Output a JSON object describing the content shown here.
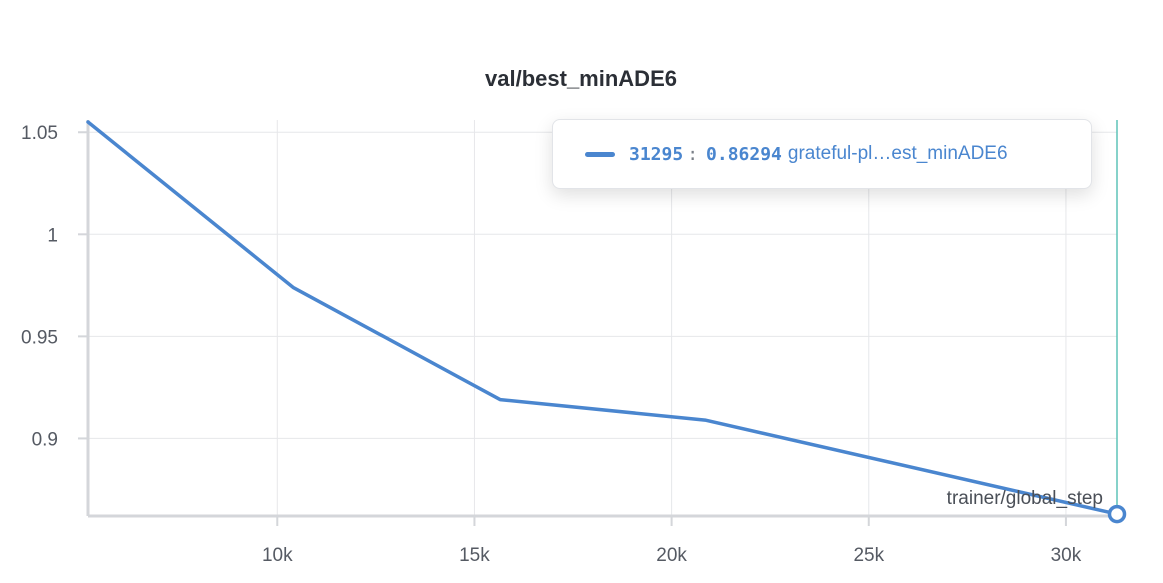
{
  "colors": {
    "series": "#4a86cf",
    "cursor": "#5fc4b8",
    "grid": "#e6e7ea",
    "axis": "#d4d6da"
  },
  "tooltip": {
    "step": "31295",
    "separator": ":",
    "value": "0.86294",
    "run_name": "grateful-pl…est_minADE6"
  },
  "chart_data": {
    "type": "line",
    "title": "val/best_minADE6",
    "xlabel": "trainer/global_step",
    "ylabel": "",
    "xlim": [
      5200,
      31295
    ],
    "ylim": [
      0.862,
      1.056
    ],
    "x_ticks": [
      10000,
      15000,
      20000,
      25000,
      30000
    ],
    "x_tick_labels": [
      "10k",
      "15k",
      "20k",
      "25k",
      "30k"
    ],
    "y_ticks": [
      0.9,
      0.95,
      1,
      1.05
    ],
    "y_tick_labels": [
      "0.9",
      "0.95",
      "1",
      "1.05"
    ],
    "grid": true,
    "series": [
      {
        "x": [
          5200,
          10400,
          15650,
          20850,
          31295
        ],
        "y": [
          1.055,
          0.974,
          0.919,
          0.909,
          0.86294
        ]
      }
    ],
    "cursor_x": 31295
  }
}
